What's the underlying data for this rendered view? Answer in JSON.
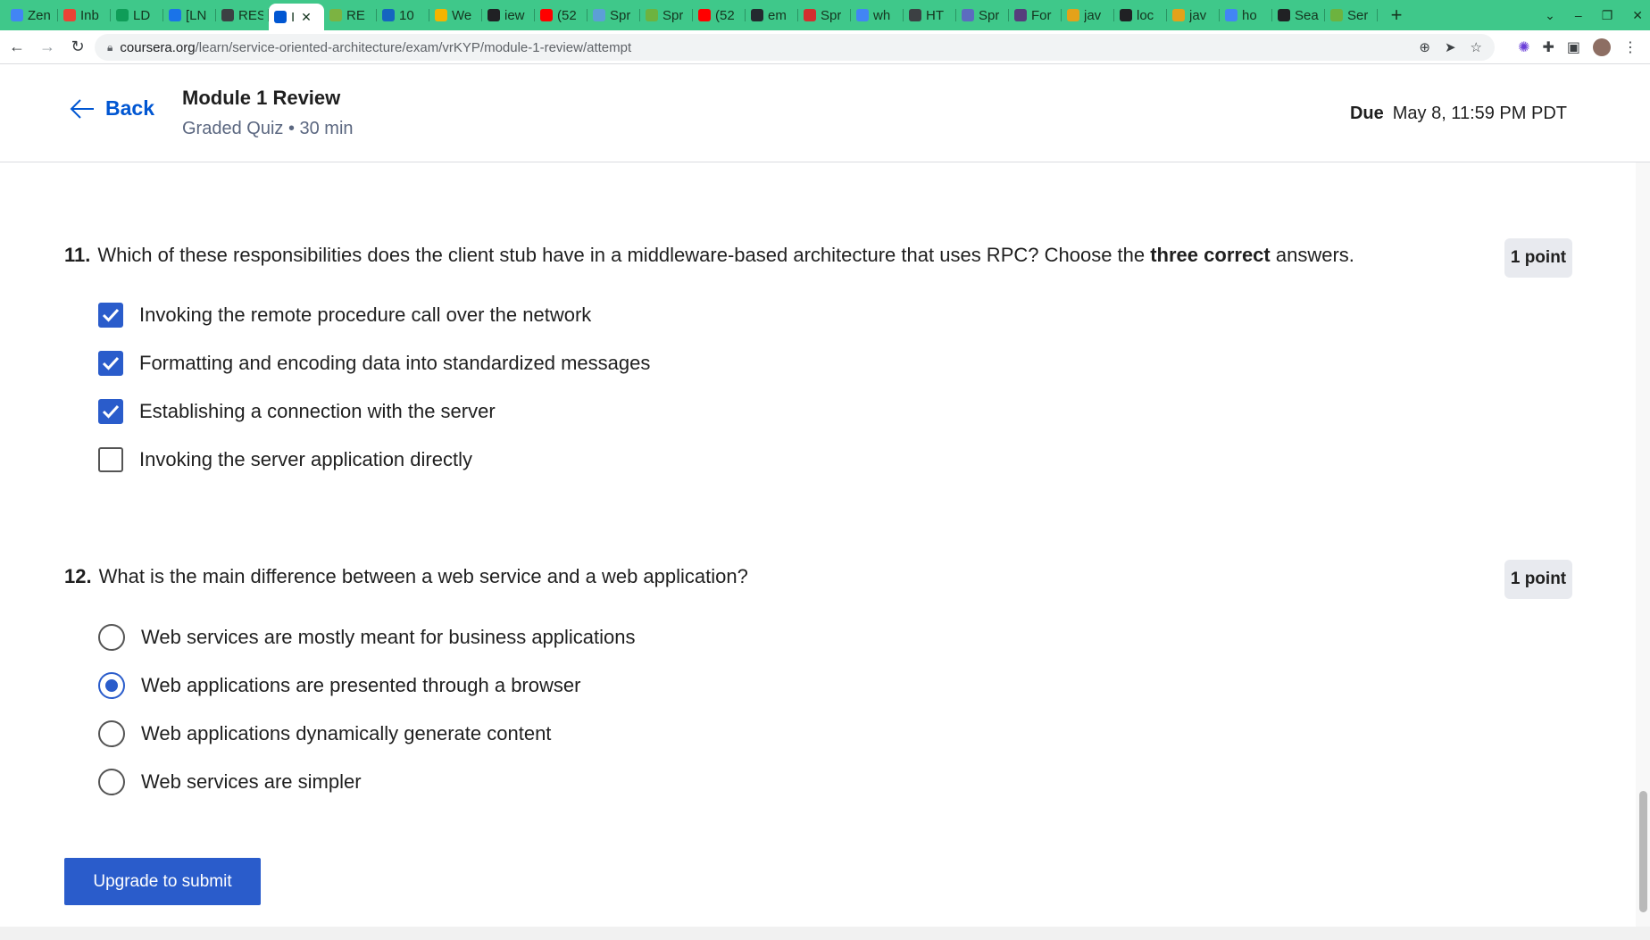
{
  "browser": {
    "tabs": [
      {
        "title": "Zen",
        "color": "#4285f4"
      },
      {
        "title": "Inb",
        "color": "#ea4335"
      },
      {
        "title": "LD",
        "color": "#0f9d58"
      },
      {
        "title": "[LN",
        "color": "#1a73e8"
      },
      {
        "title": "RES",
        "color": "#3c4043"
      },
      {
        "title": "I",
        "color": "#0056d2",
        "active": true
      },
      {
        "title": "RE",
        "color": "#7cb342"
      },
      {
        "title": "10",
        "color": "#1565c0"
      },
      {
        "title": "We",
        "color": "#f4b400"
      },
      {
        "title": "iew",
        "color": "#202124"
      },
      {
        "title": "(52",
        "color": "#ff0000"
      },
      {
        "title": "Spr",
        "color": "#5c9fd6"
      },
      {
        "title": "Spr",
        "color": "#6db33f"
      },
      {
        "title": "(52",
        "color": "#ff0000"
      },
      {
        "title": "em",
        "color": "#24292f"
      },
      {
        "title": "Spr",
        "color": "#d32f2f"
      },
      {
        "title": "wh",
        "color": "#4285f4"
      },
      {
        "title": "HT",
        "color": "#3c4043"
      },
      {
        "title": "Spr",
        "color": "#5c6bc0"
      },
      {
        "title": "For",
        "color": "#563d7c"
      },
      {
        "title": "jav",
        "color": "#e3a21a"
      },
      {
        "title": "loc",
        "color": "#202124"
      },
      {
        "title": "jav",
        "color": "#e3a21a"
      },
      {
        "title": "ho",
        "color": "#4285f4"
      },
      {
        "title": "Sea",
        "color": "#202124"
      },
      {
        "title": "Ser",
        "color": "#6db33f"
      }
    ],
    "new_tab": "+",
    "url_host": "coursera.org",
    "url_path": "/learn/service-oriented-architecture/exam/vrKYP/module-1-review/attempt"
  },
  "header": {
    "back_label": "Back",
    "title": "Module 1 Review",
    "subtitle": "Graded Quiz • 30 min",
    "due_label": "Due",
    "due_value": "May 8, 11:59 PM PDT"
  },
  "questions": [
    {
      "number": "11.",
      "text_before": "Which of these responsibilities does the client stub have in a middleware-based architecture that uses RPC? Choose the ",
      "text_bold": "three correct",
      "text_after": " answers.",
      "points": "1 point",
      "type": "checkbox",
      "options": [
        {
          "label": "Invoking the remote procedure call over the network",
          "checked": true
        },
        {
          "label": "Formatting and encoding data into standardized messages",
          "checked": true
        },
        {
          "label": "Establishing a connection with the server",
          "checked": true
        },
        {
          "label": "Invoking the server application directly",
          "checked": false
        }
      ]
    },
    {
      "number": "12.",
      "text": "What is the main difference between a web service and a web application?",
      "points": "1 point",
      "type": "radio",
      "options": [
        {
          "label": "Web services are mostly meant for business applications",
          "checked": false
        },
        {
          "label": "Web applications are presented through a browser",
          "checked": true
        },
        {
          "label": "Web applications dynamically generate content",
          "checked": false
        },
        {
          "label": "Web services are simpler",
          "checked": false
        }
      ]
    }
  ],
  "submit_label": "Upgrade to submit",
  "colors": {
    "accent": "#2a5ccb",
    "link": "#0056d2",
    "tabstrip": "#3fc88a"
  }
}
